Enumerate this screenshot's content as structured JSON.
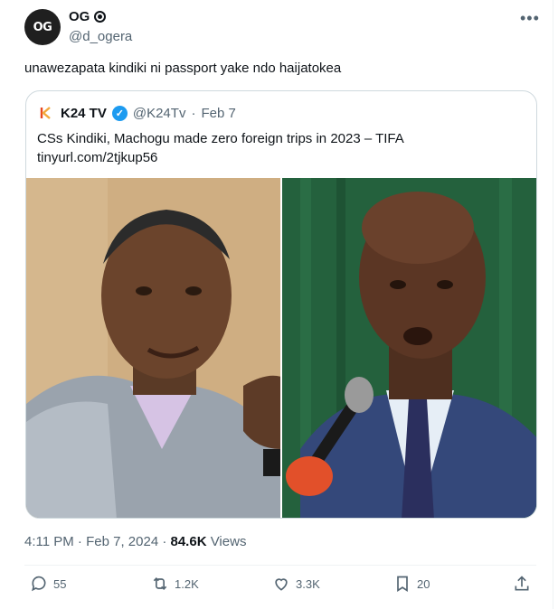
{
  "author": {
    "avatar_text": "OG",
    "name": "OG",
    "handle": "@d_ogera"
  },
  "more_label": "•••",
  "tweet_text": "unawezapata kindiki ni passport yake ndo haijatokea",
  "quote": {
    "logo_text": "K",
    "name": "K24 TV",
    "handle": "@K24Tv",
    "separator": "·",
    "date": "Feb 7",
    "text_line1": "CSs Kindiki, Machogu made zero foreign trips in 2023 – TIFA",
    "text_line2": "tinyurl.com/2tjkup56"
  },
  "meta": {
    "time": "4:11 PM",
    "separator": "·",
    "date": "Feb 7, 2024",
    "separator2": "·",
    "views_count": "84.6K",
    "views_label": "Views"
  },
  "actions": {
    "replies": "55",
    "reposts": "1.2K",
    "likes": "3.3K",
    "bookmarks": "20"
  },
  "colors": {
    "accent": "#1d9bf0",
    "text": "#0f1419",
    "muted": "#536471",
    "border": "#cfd9de"
  }
}
